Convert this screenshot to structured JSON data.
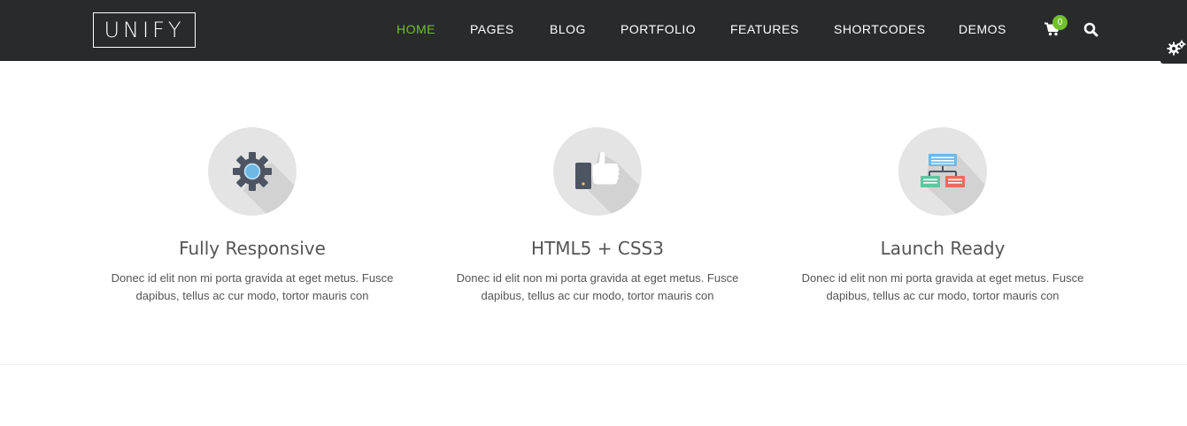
{
  "header": {
    "logo": "UNIFY",
    "nav": [
      {
        "label": "HOME",
        "active": true
      },
      {
        "label": "PAGES",
        "active": false
      },
      {
        "label": "BLOG",
        "active": false
      },
      {
        "label": "PORTFOLIO",
        "active": false
      },
      {
        "label": "FEATURES",
        "active": false
      },
      {
        "label": "SHORTCODES",
        "active": false
      },
      {
        "label": "DEMOS",
        "active": false
      }
    ],
    "cart_count": "0",
    "cart_icon": "shopping-cart-icon",
    "search_icon": "search-icon",
    "settings_icon": "gears-icon"
  },
  "features": [
    {
      "title": "Fully Responsive",
      "text": "Donec id elit non mi porta gravida at eget metus. Fusce dapibus, tellus ac cur modo, tortor mauris con",
      "icon": "gear-icon"
    },
    {
      "title": "HTML5 + CSS3",
      "text": "Donec id elit non mi porta gravida at eget metus. Fusce dapibus, tellus ac cur modo, tortor mauris con",
      "icon": "thumbs-up-icon"
    },
    {
      "title": "Launch Ready",
      "text": "Donec id elit non mi porta gravida at eget metus. Fusce dapibus, tellus ac cur modo, tortor mauris con",
      "icon": "sitemap-icon"
    }
  ],
  "colors": {
    "accent": "#72c02c",
    "header_bg": "#282a2b",
    "icon_circle": "#e4e4e4"
  }
}
